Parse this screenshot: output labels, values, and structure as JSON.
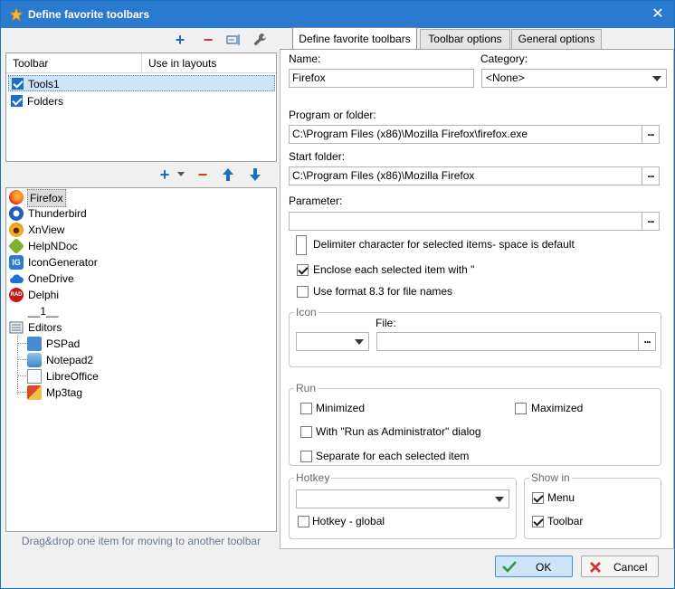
{
  "title": "Define favorite toolbars",
  "toolbar_list": {
    "col_toolbar": "Toolbar",
    "col_layouts": "Use in layouts",
    "rows": [
      {
        "label": "Tools1",
        "checked": true,
        "selected": true
      },
      {
        "label": "Folders",
        "checked": true,
        "selected": false
      }
    ]
  },
  "items": [
    {
      "label": "Firefox",
      "icon": "firefox-icon",
      "color": "#e66000"
    },
    {
      "label": "Thunderbird",
      "icon": "thunderbird-icon",
      "color": "#1f5fbf"
    },
    {
      "label": "XnView",
      "icon": "xnview-icon",
      "color": "#e9a31c"
    },
    {
      "label": "HelpNDoc",
      "icon": "helpndoc-icon",
      "color": "#7bb32e"
    },
    {
      "label": "IconGenerator",
      "icon": "icongenerator-icon",
      "color": "#2b7bd4"
    },
    {
      "label": "OneDrive",
      "icon": "onedrive-icon",
      "color": "#1a73d6"
    },
    {
      "label": "Delphi",
      "icon": "delphi-icon",
      "color": "#c11b17"
    },
    {
      "label": "__1__",
      "icon": "separator-icon",
      "color": ""
    },
    {
      "label": "Editors",
      "icon": "editors-folder-icon",
      "color": "#5b6b80"
    }
  ],
  "sub_items": [
    {
      "label": "PSPad",
      "icon": "pspad-icon",
      "color": "#4a8ad0"
    },
    {
      "label": "Notepad2",
      "icon": "notepad2-icon",
      "color": "#3a86c8"
    },
    {
      "label": "LibreOffice",
      "icon": "libreoffice-icon",
      "color": "#7c8a98"
    },
    {
      "label": "Mp3tag",
      "icon": "mp3tag-icon",
      "color": "#d84b2a"
    }
  ],
  "footer_hint": "Drag&drop one item for moving to another toolbar",
  "tabs": [
    "Define favorite toolbars",
    "Toolbar options",
    "General options"
  ],
  "form": {
    "name_label": "Name:",
    "name_value": "Firefox",
    "category_label": "Category:",
    "category_value": "<None>",
    "program_label": "Program or folder:",
    "program_value": "C:\\Program Files (x86)\\Mozilla Firefox\\firefox.exe",
    "start_label": "Start folder:",
    "start_value": "C:\\Program Files (x86)\\Mozilla Firefox",
    "param_label": "Parameter:",
    "param_value": "",
    "delimiter_label": "Delimiter character for selected items- space is default",
    "enclose_label": "Enclose each selected item with \"",
    "format83_label": "Use format 8.3 for file names",
    "dots": "...",
    "icon_group": "Icon",
    "file_label": "File:",
    "run_group": "Run",
    "minimized": "Minimized",
    "maximized": "Maximized",
    "runas": "With \"Run as Administrator\" dialog",
    "separate": "Separate for each selected item",
    "hotkey_group": "Hotkey",
    "hotkey_global": "Hotkey - global",
    "showin_group": "Show in",
    "menu": "Menu",
    "toolbar": "Toolbar"
  },
  "buttons": {
    "ok": "OK",
    "cancel": "Cancel"
  },
  "colors": {
    "accent": "#1f6dc8",
    "titlebar": "#2a7bd0",
    "minus": "#d8312b"
  }
}
